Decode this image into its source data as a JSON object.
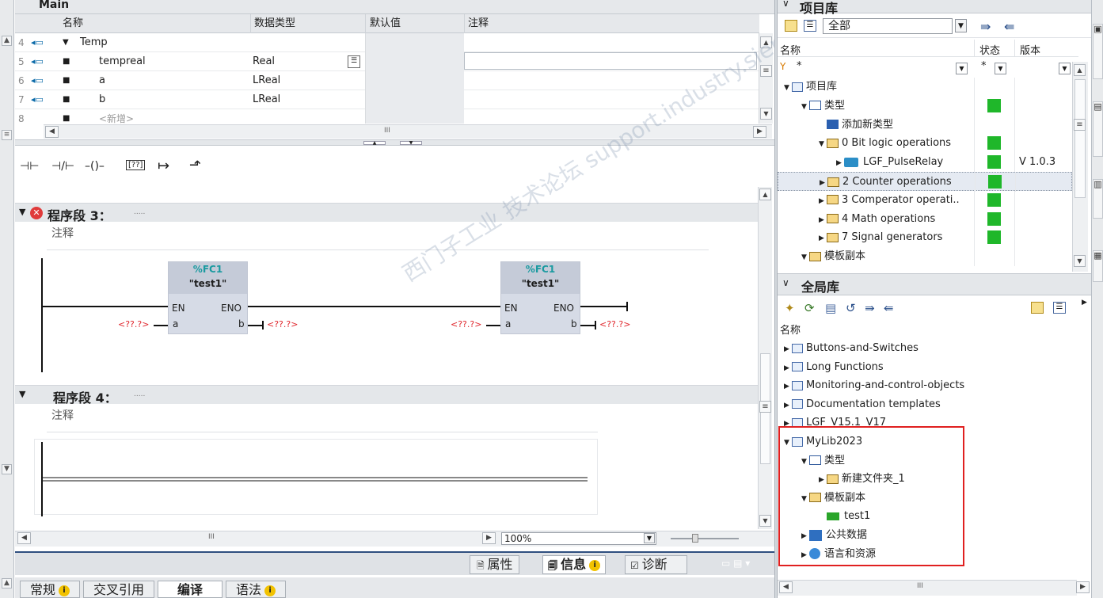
{
  "iface": {
    "title": "Main",
    "columns": [
      "名称",
      "数据类型",
      "默认值",
      "注释"
    ],
    "rows": [
      {
        "n": "4",
        "name": "Temp",
        "type": ""
      },
      {
        "n": "5",
        "name": "tempreal",
        "type": "Real"
      },
      {
        "n": "6",
        "name": "a",
        "type": "LReal"
      },
      {
        "n": "7",
        "name": "b",
        "type": "LReal"
      },
      {
        "n": "8",
        "name": "<新增>",
        "type": ""
      }
    ]
  },
  "palette": {
    "contact_no": "⊣⊢",
    "contact_nc": "⊣/⊢",
    "coil": "–()–",
    "empty_box": "[??]",
    "branch_open": "↦",
    "branch_close": "⬏"
  },
  "net3": {
    "title": "程序段 3：",
    "dots": ".....",
    "comment": "注释",
    "block1": {
      "addr": "%FC1",
      "name": "\"test1\"",
      "en": "EN",
      "eno": "ENO",
      "in": "a",
      "out": "b",
      "in_val": "<??.?>",
      "out_val": "<??.?>"
    },
    "block2": {
      "addr": "%FC1",
      "name": "\"test1\"",
      "en": "EN",
      "eno": "ENO",
      "in": "a",
      "out": "b",
      "in_val": "<??.?>",
      "out_val": "<??.?>"
    }
  },
  "net4": {
    "title": "程序段 4：",
    "dots": ".....",
    "comment": "注释"
  },
  "editor_status": {
    "zoom": "100%",
    "scroll_mid": "III"
  },
  "inspector_tabs": {
    "props": "属性",
    "info": "信息",
    "diag": "诊断"
  },
  "bottom_tabs": [
    "常规",
    "交叉引用",
    "编译",
    "语法"
  ],
  "project_lib": {
    "title": "项目库",
    "filter": "全部",
    "cols": [
      "名称",
      "状态",
      "版本"
    ],
    "filter_row": {
      "name": "*",
      "state": "*"
    },
    "tree": [
      {
        "indent": 0,
        "label": "项目库",
        "icon": "book",
        "open": true
      },
      {
        "indent": 1,
        "label": "类型",
        "icon": "folder-blue",
        "open": true,
        "status": true
      },
      {
        "indent": 2,
        "label": "添加新类型",
        "icon": "star"
      },
      {
        "indent": 2,
        "label": "0 Bit logic operations",
        "icon": "folder",
        "open": true,
        "status": true
      },
      {
        "indent": 3,
        "label": "LGF_PulseRelay",
        "icon": "block",
        "status": true,
        "version": "V 1.0.3"
      },
      {
        "indent": 2,
        "label": "2 Counter operations",
        "icon": "folder",
        "status": true,
        "selected": true
      },
      {
        "indent": 2,
        "label": "3 Comperator operati..",
        "icon": "folder",
        "status": true
      },
      {
        "indent": 2,
        "label": "4 Math operations",
        "icon": "folder",
        "status": true
      },
      {
        "indent": 2,
        "label": "7 Signal generators",
        "icon": "folder",
        "status": true
      },
      {
        "indent": 1,
        "label": "模板副本",
        "icon": "folder",
        "open": true
      }
    ]
  },
  "global_lib": {
    "title": "全局库",
    "col": "名称",
    "tree": [
      {
        "indent": 0,
        "label": "Buttons-and-Switches",
        "icon": "book"
      },
      {
        "indent": 0,
        "label": "Long Functions",
        "icon": "book"
      },
      {
        "indent": 0,
        "label": "Monitoring-and-control-objects",
        "icon": "book"
      },
      {
        "indent": 0,
        "label": "Documentation templates",
        "icon": "book"
      },
      {
        "indent": 0,
        "label": "LGF_V15.1_V17",
        "icon": "book"
      },
      {
        "indent": 0,
        "label": "MyLib2023",
        "icon": "book",
        "open": true
      },
      {
        "indent": 1,
        "label": "类型",
        "icon": "folder-blue",
        "open": true
      },
      {
        "indent": 2,
        "label": "新建文件夹_1",
        "icon": "folder"
      },
      {
        "indent": 1,
        "label": "模板副本",
        "icon": "folder",
        "open": true
      },
      {
        "indent": 2,
        "label": "test1",
        "icon": "green-block"
      },
      {
        "indent": 1,
        "label": "公共数据",
        "icon": "data"
      },
      {
        "indent": 1,
        "label": "语言和资源",
        "icon": "globe"
      }
    ],
    "scroll_mid": "III"
  },
  "watermark": "西门子工业 技术论坛 support.industry.siemens.com/cs",
  "colors": {
    "green": "#1fb72a",
    "highlight": "#e02020",
    "teal": "#1a9aa0",
    "red_text": "#e0282e"
  }
}
